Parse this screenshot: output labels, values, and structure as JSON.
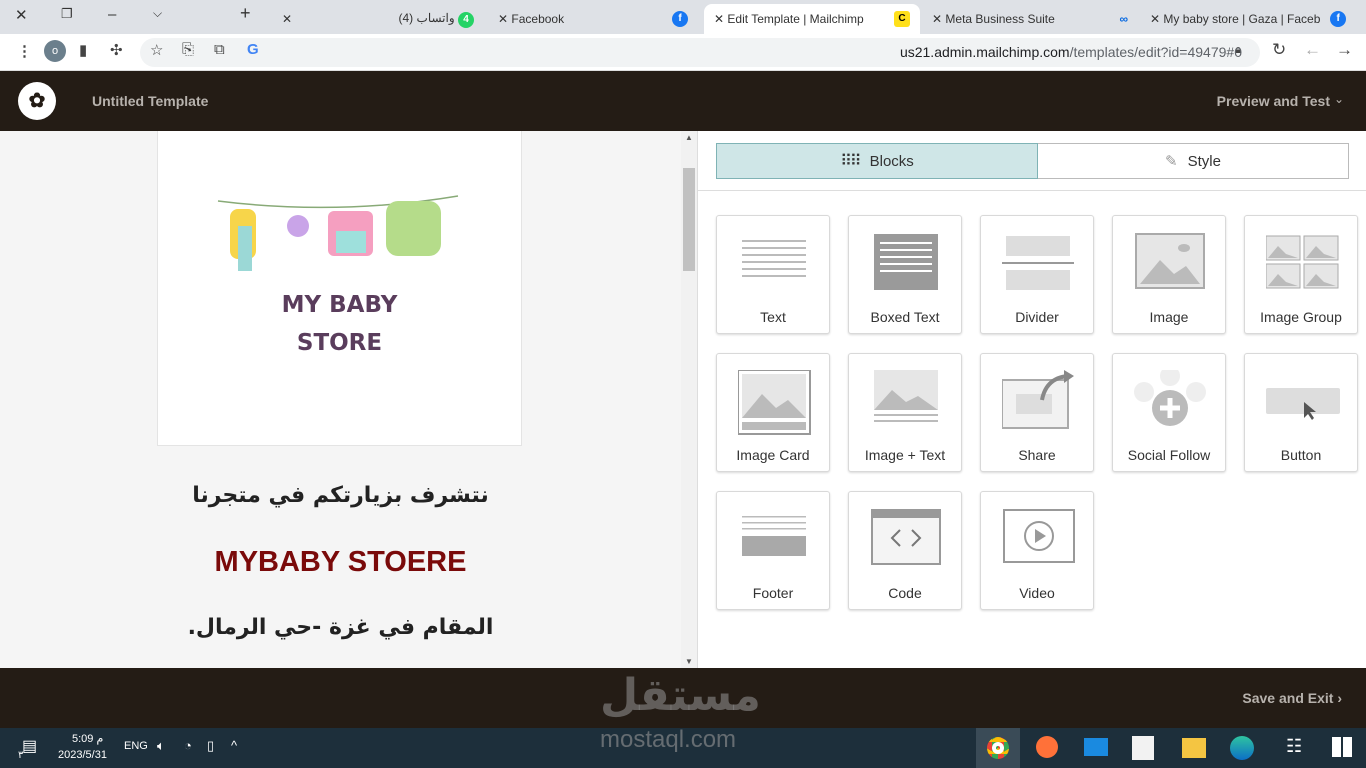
{
  "browser": {
    "tabs": [
      {
        "label": "(4) واتساب",
        "badge": "4"
      },
      {
        "label": "Facebook"
      },
      {
        "label": "Edit Template | Mailchimp",
        "active": true
      },
      {
        "label": "Meta Business Suite"
      },
      {
        "label": "My baby store | Gaza | Faceb"
      }
    ],
    "url_host": "us21.admin.mailchimp.com",
    "url_path": "/templates/edit?id=49479#0",
    "profile_initial": "o"
  },
  "app": {
    "title": "Untitled Template",
    "preview": "Preview and Test",
    "save_exit": "Save and Exit"
  },
  "email": {
    "logo_line1": "MY BABY",
    "logo_line2": "STORE",
    "ar_line1": "نتشرف بزيارتكم في متجرنا",
    "brand": "MYBABY STOERE",
    "ar_line2": "المقام في غزة -حي الرمال."
  },
  "panel": {
    "tab_blocks": "Blocks",
    "tab_style": "Style",
    "blocks": [
      "Text",
      "Boxed Text",
      "Divider",
      "Image",
      "Image Group",
      "Image Card",
      "Image + Text",
      "Share",
      "Social Follow",
      "Button",
      "Footer",
      "Code",
      "Video"
    ]
  },
  "taskbar": {
    "time": "5:09 م",
    "date": "2023/5/31",
    "lang": "ENG",
    "notif": "٣"
  },
  "watermark": {
    "ar": "مستقل",
    "en": "mostaql.com"
  },
  "colors": {
    "header": "#241c15",
    "brand_red": "#7a0a0a",
    "tab_active": "#cfe6e7",
    "taskbar": "#1d2f3b"
  }
}
